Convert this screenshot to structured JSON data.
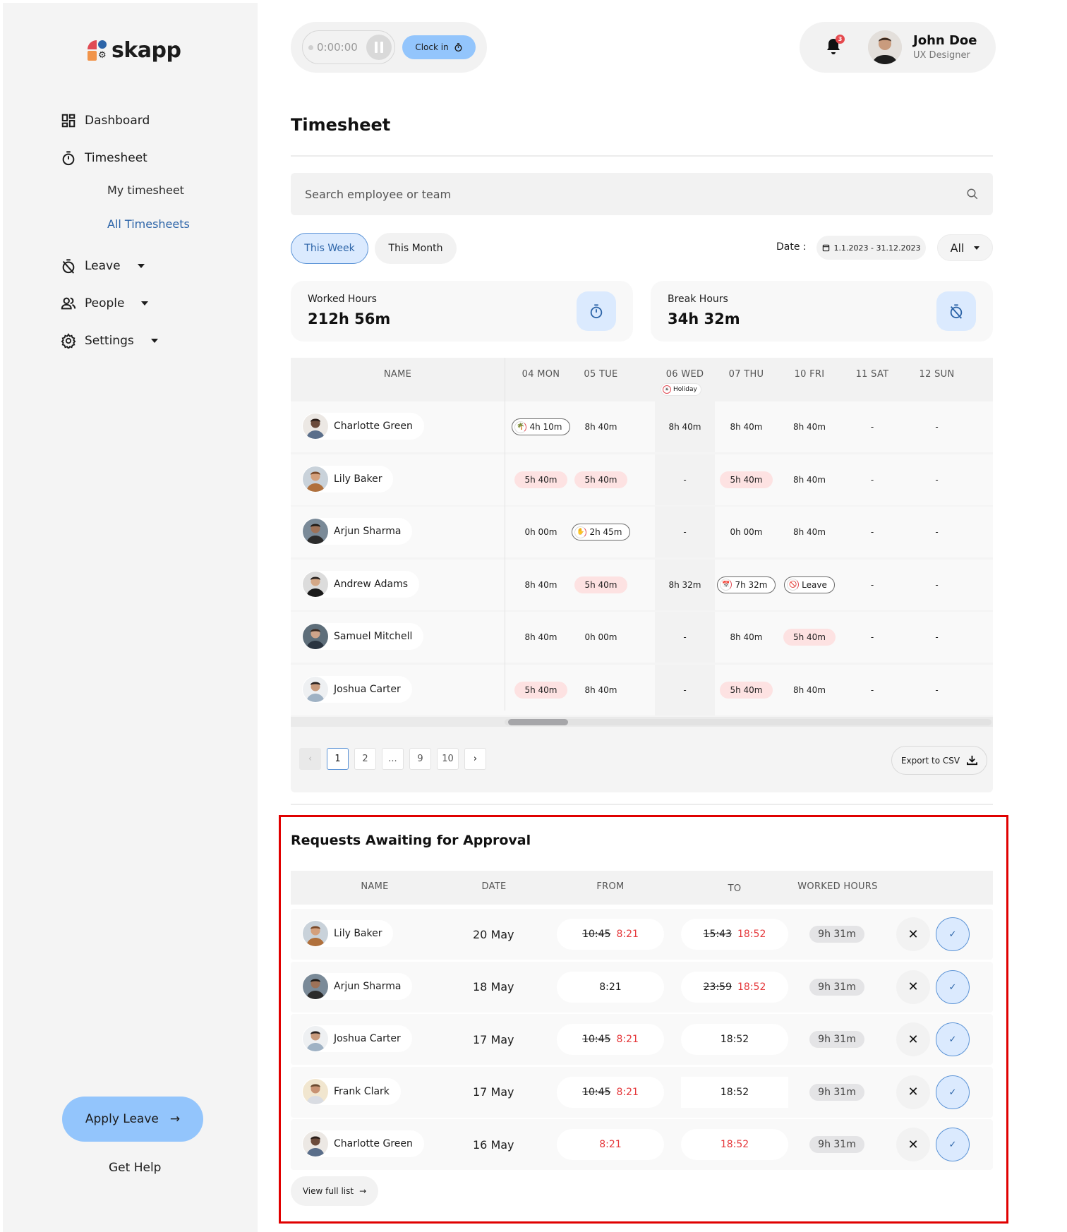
{
  "brand": {
    "name": "skapp"
  },
  "sidebar": {
    "items": [
      {
        "label": "Dashboard",
        "icon": "dashboard-icon"
      },
      {
        "label": "Timesheet",
        "icon": "stopwatch-icon"
      },
      {
        "label": "Leave",
        "icon": "leave-icon",
        "has_dropdown": true
      },
      {
        "label": "People",
        "icon": "people-icon",
        "has_dropdown": true
      },
      {
        "label": "Settings",
        "icon": "gear-icon",
        "has_dropdown": true
      }
    ],
    "timesheet_sub": [
      {
        "label": "My timesheet",
        "active": false
      },
      {
        "label": "All Timesheets",
        "active": true
      }
    ],
    "apply_leave": "Apply Leave",
    "get_help": "Get Help"
  },
  "topbar": {
    "timer": "0:00:00",
    "clock_in": "Clock in",
    "notification_count": "3",
    "user": {
      "name": "John Doe",
      "role": "UX Designer"
    }
  },
  "page": {
    "title": "Timesheet",
    "search_placeholder": "Search employee or team",
    "tabs": [
      {
        "label": "This Week",
        "active": true
      },
      {
        "label": "This Month",
        "active": false
      }
    ],
    "date_label": "Date :",
    "date_range": "1.1.2023 - 31.12.2023",
    "filter": "All"
  },
  "stats": {
    "worked": {
      "label": "Worked Hours",
      "value": "212h 56m"
    },
    "break": {
      "label": "Break Hours",
      "value": "34h 32m"
    }
  },
  "timesheet": {
    "name_header": "NAME",
    "days": [
      "04 MON",
      "05 TUE",
      "06 WED",
      "07 THU",
      "10 FRI",
      "11 SAT",
      "12 SUN"
    ],
    "holiday_label": "Holiday",
    "rows": [
      {
        "name": "Charlotte Green",
        "cells": [
          {
            "v": "4h 10m",
            "t": "outline",
            "icon": "palm"
          },
          {
            "v": "8h 40m"
          },
          {
            "v": "8h 40m"
          },
          {
            "v": "8h 40m"
          },
          {
            "v": "8h 40m"
          },
          {
            "v": "-"
          },
          {
            "v": "-"
          }
        ]
      },
      {
        "name": "Lily Baker",
        "cells": [
          {
            "v": "5h 40m",
            "t": "red"
          },
          {
            "v": "5h 40m",
            "t": "red"
          },
          {
            "v": "-"
          },
          {
            "v": "5h 40m",
            "t": "red"
          },
          {
            "v": "8h 40m"
          },
          {
            "v": "-"
          },
          {
            "v": "-"
          }
        ]
      },
      {
        "name": "Arjun Sharma",
        "cells": [
          {
            "v": "0h 00m"
          },
          {
            "v": "2h 45m",
            "t": "outline",
            "icon": "sick"
          },
          {
            "v": "-"
          },
          {
            "v": "0h 00m"
          },
          {
            "v": "8h 40m"
          },
          {
            "v": "-"
          },
          {
            "v": "-"
          }
        ]
      },
      {
        "name": "Andrew Adams",
        "cells": [
          {
            "v": "8h 40m"
          },
          {
            "v": "5h 40m",
            "t": "red"
          },
          {
            "v": "8h 32m"
          },
          {
            "v": "7h 32m",
            "t": "outline",
            "icon": "calendar"
          },
          {
            "v": "Leave",
            "t": "outline",
            "icon": "leave"
          },
          {
            "v": "-"
          },
          {
            "v": "-"
          }
        ]
      },
      {
        "name": "Samuel Mitchell",
        "cells": [
          {
            "v": "8h 40m"
          },
          {
            "v": "0h 00m"
          },
          {
            "v": "-"
          },
          {
            "v": "8h 40m"
          },
          {
            "v": "5h 40m",
            "t": "red"
          },
          {
            "v": "-"
          },
          {
            "v": "-"
          }
        ]
      },
      {
        "name": "Joshua Carter",
        "cells": [
          {
            "v": "5h 40m",
            "t": "red"
          },
          {
            "v": "8h 40m"
          },
          {
            "v": "-"
          },
          {
            "v": "5h 40m",
            "t": "red"
          },
          {
            "v": "8h 40m"
          },
          {
            "v": "-"
          },
          {
            "v": "-"
          }
        ]
      }
    ],
    "pagination": {
      "pages": [
        "1",
        "2",
        "...",
        "9",
        "10"
      ],
      "current": "1"
    },
    "export_label": "Export to CSV"
  },
  "requests": {
    "title": "Requests Awaiting for Approval",
    "headers": [
      "NAME",
      "DATE",
      "FROM",
      "TO",
      "WORKED HOURS"
    ],
    "rows": [
      {
        "name": "Lily Baker",
        "date": "20 May",
        "from_old": "10:45",
        "from_new": "8:21",
        "to_old": "15:43",
        "to_new": "18:52",
        "hours": "9h 31m"
      },
      {
        "name": "Arjun Sharma",
        "date": "18 May",
        "from_old": "",
        "from_new": "8:21",
        "from_plain": true,
        "to_old": "23:59",
        "to_new": "18:52",
        "hours": "9h 31m"
      },
      {
        "name": "Joshua Carter",
        "date": "17 May",
        "from_old": "10:45",
        "from_new": "8:21",
        "to_old": "",
        "to_new": "18:52",
        "to_plain": true,
        "hours": "9h 31m"
      },
      {
        "name": "Frank Clark",
        "date": "17 May",
        "from_old": "10:45",
        "from_new": "8:21",
        "to_old": "",
        "to_new": "18:52",
        "to_plain": true,
        "hours": "9h 31m"
      },
      {
        "name": "Charlotte Green",
        "date": "16 May",
        "from_old": "",
        "from_new": "8:21",
        "to_old": "",
        "to_new": "18:52",
        "hours": "9h 31m"
      }
    ],
    "view_full": "View full list"
  },
  "colors": {
    "accent": "#93c5fc",
    "accent_soft": "#dbeafe",
    "link": "#2c64a8",
    "late": "#fde2e2",
    "changed_time": "#e5383b"
  }
}
